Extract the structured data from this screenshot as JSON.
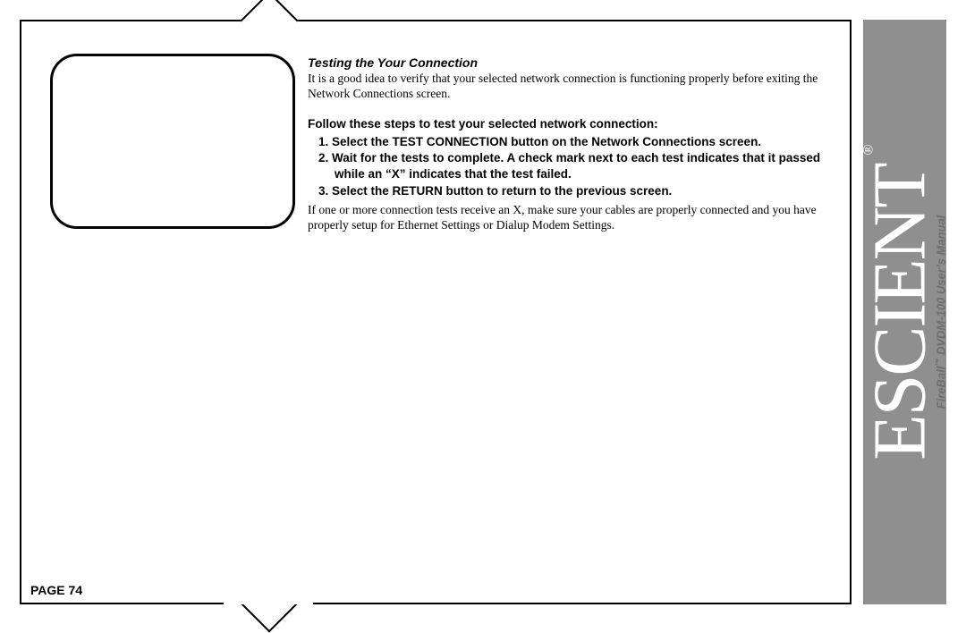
{
  "section_title": "Testing the Your Connection",
  "intro": "It is a good idea to verify that your selected network connection is functioning properly before exiting the Network Connections screen.",
  "steps_lead": "Follow these steps to test your selected network connection:",
  "steps": [
    "Select the TEST CONNECTION button on the Network Connections screen.",
    "Wait for the tests to complete. A check mark next to each test indicates that it passed while an “X” indicates that the test failed.",
    "Select the RETURN button to return to the previous screen."
  ],
  "outro": "If one or more connection tests receive an X, make sure your cables are properly connected and you have properly setup for Ethernet Settings or Dialup Modem Settings.",
  "page_label": "PAGE 74",
  "sidebar": {
    "brand": "ESCIENT",
    "reg": "®",
    "product": "FireBall",
    "tm": "™",
    "model": " DVDM-100 ",
    "doc": "User’s Manual"
  }
}
